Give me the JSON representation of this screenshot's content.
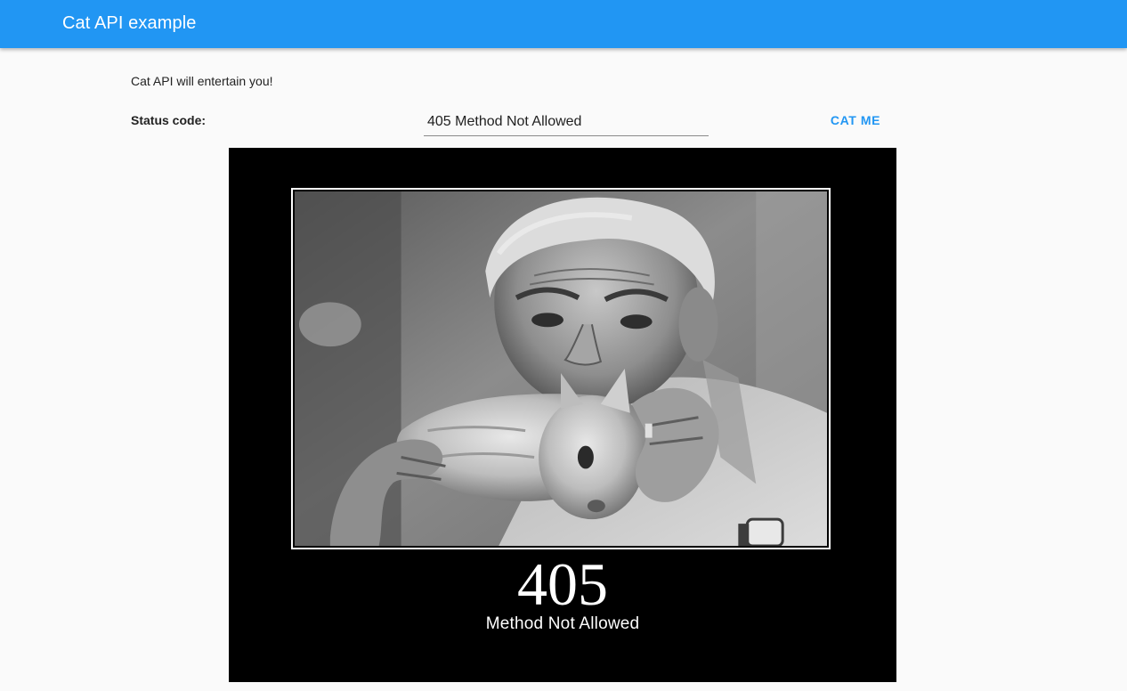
{
  "appbar": {
    "title": "Cat API example",
    "color": "#2196f3"
  },
  "intro_text": "Cat API will entertain you!",
  "form": {
    "status_label": "Status code:",
    "status_value": "405 Method Not Allowed",
    "button_label": "CAT ME",
    "button_color": "#2196f3"
  },
  "cat_image": {
    "code": "405",
    "message": "Method Not Allowed",
    "photo_icon": "man-holding-kitten-photo"
  }
}
